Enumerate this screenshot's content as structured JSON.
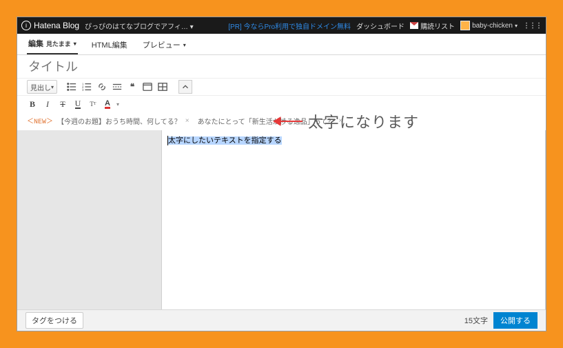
{
  "topbar": {
    "brand": "Hatena Blog",
    "blog_name": "ぴっぴのはてなブログでアフィ… ▾",
    "pr_link": "[PR] 今ならPro利用で独自ドメイン無料",
    "dashboard": "ダッシュボード",
    "delivery_list": "購読リスト",
    "user": "baby-chicken"
  },
  "tabs": {
    "edit": "編集",
    "edit_sub": "見たまま",
    "html": "HTML編集",
    "preview": "プレビュー"
  },
  "title_placeholder": "タイトル",
  "toolbar1": {
    "heading_select": "見出し"
  },
  "suggestion": {
    "new_badge": "＜NEW＞",
    "q1": "【今週のお題】おうち時間、何してる？",
    "q2": "あなたにとって「新生活が捗る逸品」って？"
  },
  "editor": {
    "sample_text": "太字にしたいテキストを指定する"
  },
  "annotation": "太字になります",
  "bottom": {
    "tag_button": "タグをつける",
    "char_count": "15文字",
    "publish": "公開する"
  }
}
